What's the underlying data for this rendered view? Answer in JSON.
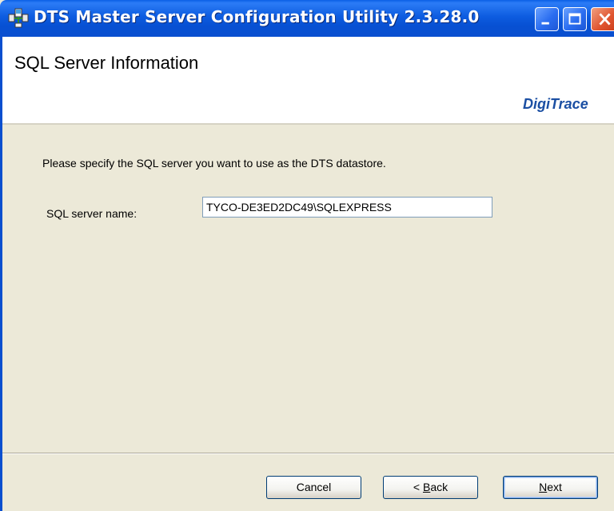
{
  "window": {
    "title": "DTS Master Server Configuration Utility 2.3.28.0",
    "icon": "app-network-icon",
    "controls": {
      "minimize": "minimize-icon",
      "maximize": "maximize-icon",
      "close": "close-icon"
    }
  },
  "header": {
    "title": "SQL Server Information",
    "brand": "DigiTrace"
  },
  "main": {
    "prompt": "Please specify the SQL server you want to use as the DTS datastore.",
    "sql_server": {
      "label": "SQL server name:",
      "value": "TYCO-DE3ED2DC49\\SQLEXPRESS"
    }
  },
  "buttons": {
    "cancel": "Cancel",
    "back_prefix": "< ",
    "back_mnemonic": "B",
    "back_rest": "ack",
    "next_mnemonic": "N",
    "next_rest": "ext"
  },
  "colors": {
    "titlebar": "#0a4fcf",
    "dialog_background": "#ece9d8",
    "brand": "#1b4fa3",
    "close_button": "#e05530"
  }
}
